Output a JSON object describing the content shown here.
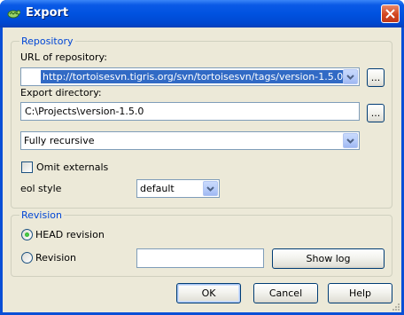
{
  "window": {
    "title": "Export",
    "icon": "tortoise-icon"
  },
  "repository": {
    "legend": "Repository",
    "url_label": "URL of repository:",
    "url_value": "http://tortoisesvn.tigris.org/svn/tortoisesvn/tags/version-1.5.0",
    "url_browse_label": "...",
    "export_dir_label": "Export directory:",
    "export_dir_value": "C:\\Projects\\version-1.5.0",
    "export_dir_browse_label": "...",
    "depth_value": "Fully recursive",
    "omit_externals_label": "Omit externals",
    "omit_externals_checked": false,
    "eol_label": "eol style",
    "eol_value": "default"
  },
  "revision": {
    "legend": "Revision",
    "head_label": "HEAD revision",
    "head_selected": true,
    "revision_label": "Revision",
    "revision_value": "",
    "show_log_label": "Show log"
  },
  "buttons": {
    "ok": "OK",
    "cancel": "Cancel",
    "help": "Help"
  },
  "colors": {
    "title_bar": "#0054e3",
    "group_legend": "#0046d5",
    "selection": "#316ac5",
    "dialog_bg": "#ece9d8"
  }
}
